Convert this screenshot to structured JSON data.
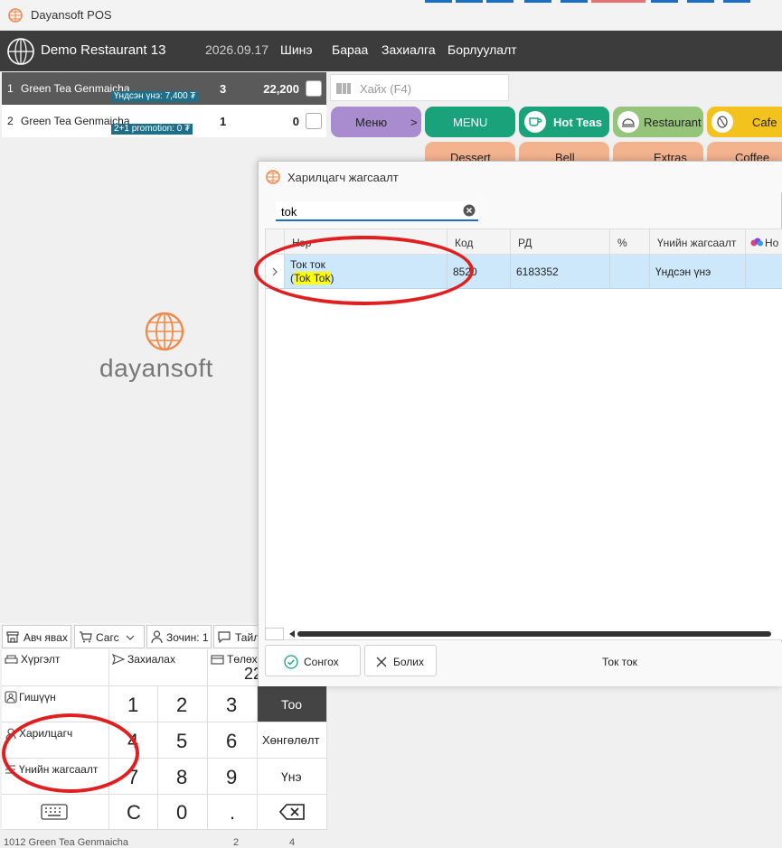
{
  "window": {
    "title": "Dayansoft POS"
  },
  "header": {
    "restaurant": "Demo Restaurant 13",
    "date": "2026.09.17",
    "nav": [
      "Шинэ",
      "Бараа",
      "Захиалга",
      "Борлуулалт"
    ]
  },
  "order_items": [
    {
      "index": "1",
      "name": "Green Tea Genmaicha",
      "badge": "Үндсэн үнэ: 7,400 ₮",
      "qty": "3",
      "amount": "22,200"
    },
    {
      "index": "2",
      "name": "Green Tea Genmaicha",
      "badge": "2+1 promotion: 0 ₮",
      "qty": "1",
      "amount": "0"
    }
  ],
  "brand": {
    "name": "dayansoft"
  },
  "product_search": {
    "placeholder": "Хайх (F4)"
  },
  "categories": [
    {
      "label": "Меню",
      "arrow": ">",
      "color": "#a98bcf"
    },
    {
      "label": "MENU",
      "color": "#1aa37a"
    },
    {
      "label": "Hot Teas",
      "color": "#1aa37a"
    },
    {
      "label": "Restaurant",
      "color": "#95c47a"
    },
    {
      "label": "Cafe",
      "color": "#f4c21d"
    },
    {
      "label": "Dessert",
      "color": "#f4b38f"
    },
    {
      "label": "Bell",
      "color": "#f4b38f"
    },
    {
      "label": "Extras",
      "color": "#f4b38f"
    },
    {
      "label": "Coffee",
      "color": "#f4b38f"
    }
  ],
  "options": {
    "takeaway": "Авч явах",
    "cart": "Сагс",
    "guest": "Зочин: 1",
    "note": "Тайл"
  },
  "keypad": {
    "delivery": "Хүргэлт",
    "order": "Захиалах",
    "pay": "Төлөх",
    "pay_amount": "22",
    "member": "Гишүүн",
    "customer": "Харилцагч",
    "price_list": "Үнийн жагсаалт",
    "digits": [
      "1",
      "2",
      "3",
      "4",
      "5",
      "6",
      "7",
      "8",
      "9"
    ],
    "qty": "Тоо",
    "discount": "Хөнгөлөлт",
    "price": "Үнэ",
    "clear": "C",
    "zero": "0",
    "dot": "."
  },
  "status_bar": {
    "item": "1012 Green Tea Genmaicha",
    "a": "2",
    "b": "4"
  },
  "dialog": {
    "title": "Харилцагч жагсаалт",
    "search_value": "tok",
    "columns": [
      "Нэр",
      "Код",
      "РД",
      "%",
      "Үнийн жагсаалт",
      "Но"
    ],
    "rows": [
      {
        "name": "Ток ток",
        "alias_prefix": "(",
        "alias": "Tok Tok",
        "alias_suffix": ")",
        "code": "8520",
        "rd": "6183352",
        "percent": "",
        "price_list": "Үндсэн үнэ"
      }
    ],
    "select_button": "Сонгох",
    "cancel_button": "Болих",
    "selected_name": "Ток ток"
  },
  "colors": {
    "header_bg": "#3c3c3c",
    "brand_orange": "#f08a4b",
    "selection_blue": "#cde8fa",
    "highlight_yellow": "#ffff00",
    "annotation_red": "#e02020",
    "keypad_dark": "#444444"
  }
}
